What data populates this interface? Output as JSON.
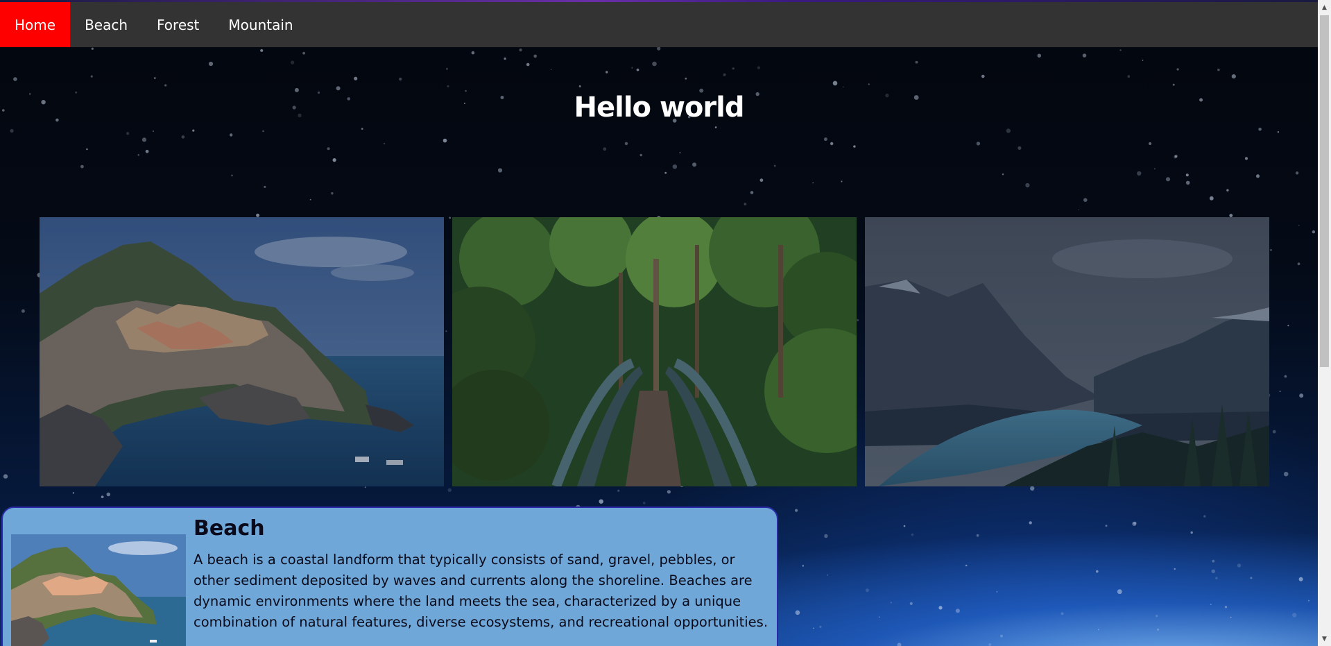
{
  "nav": {
    "items": [
      {
        "label": "Home",
        "active": true
      },
      {
        "label": "Beach",
        "active": false
      },
      {
        "label": "Forest",
        "active": false
      },
      {
        "label": "Mountain",
        "active": false
      }
    ],
    "active_color": "#ff0000",
    "bar_color": "#333333"
  },
  "hero": {
    "title": "Hello world"
  },
  "gallery": [
    {
      "image": "beach-village-cliff-photo"
    },
    {
      "image": "forest-bridge-photo"
    },
    {
      "image": "mountain-lake-photo"
    }
  ],
  "card": {
    "title": "Beach",
    "description": "A beach is a coastal landform that typically consists of sand, gravel, pebbles, or other sediment deposited by waves and currents along the shoreline. Beaches are dynamic environments where the land meets the sea, characterized by a unique combination of natural features, diverse ecosystems, and recreational opportunities.",
    "image": "beach-village-cliff-photo",
    "background_color": "#6fa8d8"
  },
  "scrollbar": {
    "icons": [
      "scroll-up-arrow-icon",
      "scroll-down-arrow-icon"
    ]
  }
}
